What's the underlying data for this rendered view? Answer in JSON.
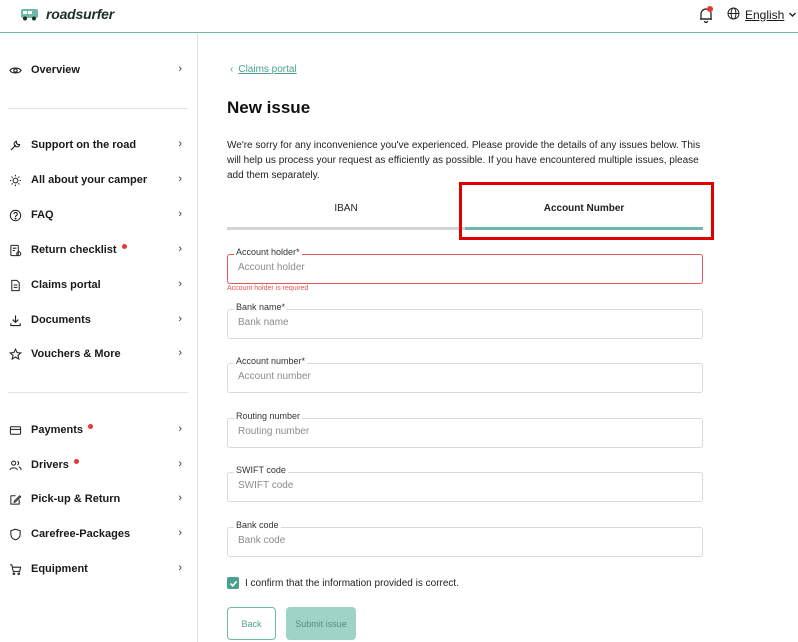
{
  "header": {
    "brand": "roadsurfer",
    "language": "English"
  },
  "sidebar": {
    "items": [
      {
        "label": "Overview",
        "icon": "eye-icon",
        "dot": false
      },
      {
        "label": "Support on the road",
        "icon": "wrench-icon",
        "dot": false
      },
      {
        "label": "All about your camper",
        "icon": "sun-icon",
        "dot": false
      },
      {
        "label": "FAQ",
        "icon": "question-icon",
        "dot": false
      },
      {
        "label": "Return checklist",
        "icon": "checklist-icon",
        "dot": true
      },
      {
        "label": "Claims portal",
        "icon": "document-icon",
        "dot": false
      },
      {
        "label": "Documents",
        "icon": "download-icon",
        "dot": false
      },
      {
        "label": "Vouchers & More",
        "icon": "star-icon",
        "dot": false
      },
      {
        "label": "Payments",
        "icon": "card-icon",
        "dot": true
      },
      {
        "label": "Drivers",
        "icon": "users-icon",
        "dot": true
      },
      {
        "label": "Pick-up & Return",
        "icon": "edit-icon",
        "dot": false
      },
      {
        "label": "Carefree-Packages",
        "icon": "shield-icon",
        "dot": false
      },
      {
        "label": "Equipment",
        "icon": "cart-icon",
        "dot": false
      }
    ]
  },
  "main": {
    "back_link": "Claims portal",
    "title": "New issue",
    "intro": "We're sorry for any inconvenience you've experienced. Please provide the details of any issues below. This will help us process your request as efficiently as possible. If you have encountered multiple issues, please add them separately.",
    "tabs": [
      "IBAN",
      "Account Number"
    ],
    "active_tab": "Account Number",
    "fields": [
      {
        "label": "Account holder*",
        "placeholder": "Account holder",
        "value": ""
      },
      {
        "label": "Bank name*",
        "placeholder": "Bank name",
        "value": ""
      },
      {
        "label": "Account number*",
        "placeholder": "Account number",
        "value": ""
      },
      {
        "label": "Routing number",
        "placeholder": "Routing number",
        "value": ""
      },
      {
        "label": "SWIFT code",
        "placeholder": "SWIFT code",
        "value": ""
      },
      {
        "label": "Bank code",
        "placeholder": "Bank code",
        "value": ""
      }
    ],
    "error_message": "Account holder is required",
    "confirm_text": "I confirm that the information provided is correct.",
    "confirm_checked": true,
    "back_button": "Back",
    "submit_button": "Submit issue"
  },
  "colors": {
    "accent": "#6fb8a8",
    "error": "#e05858",
    "highlight": "#e00000",
    "notification_dot": "#e53935"
  }
}
